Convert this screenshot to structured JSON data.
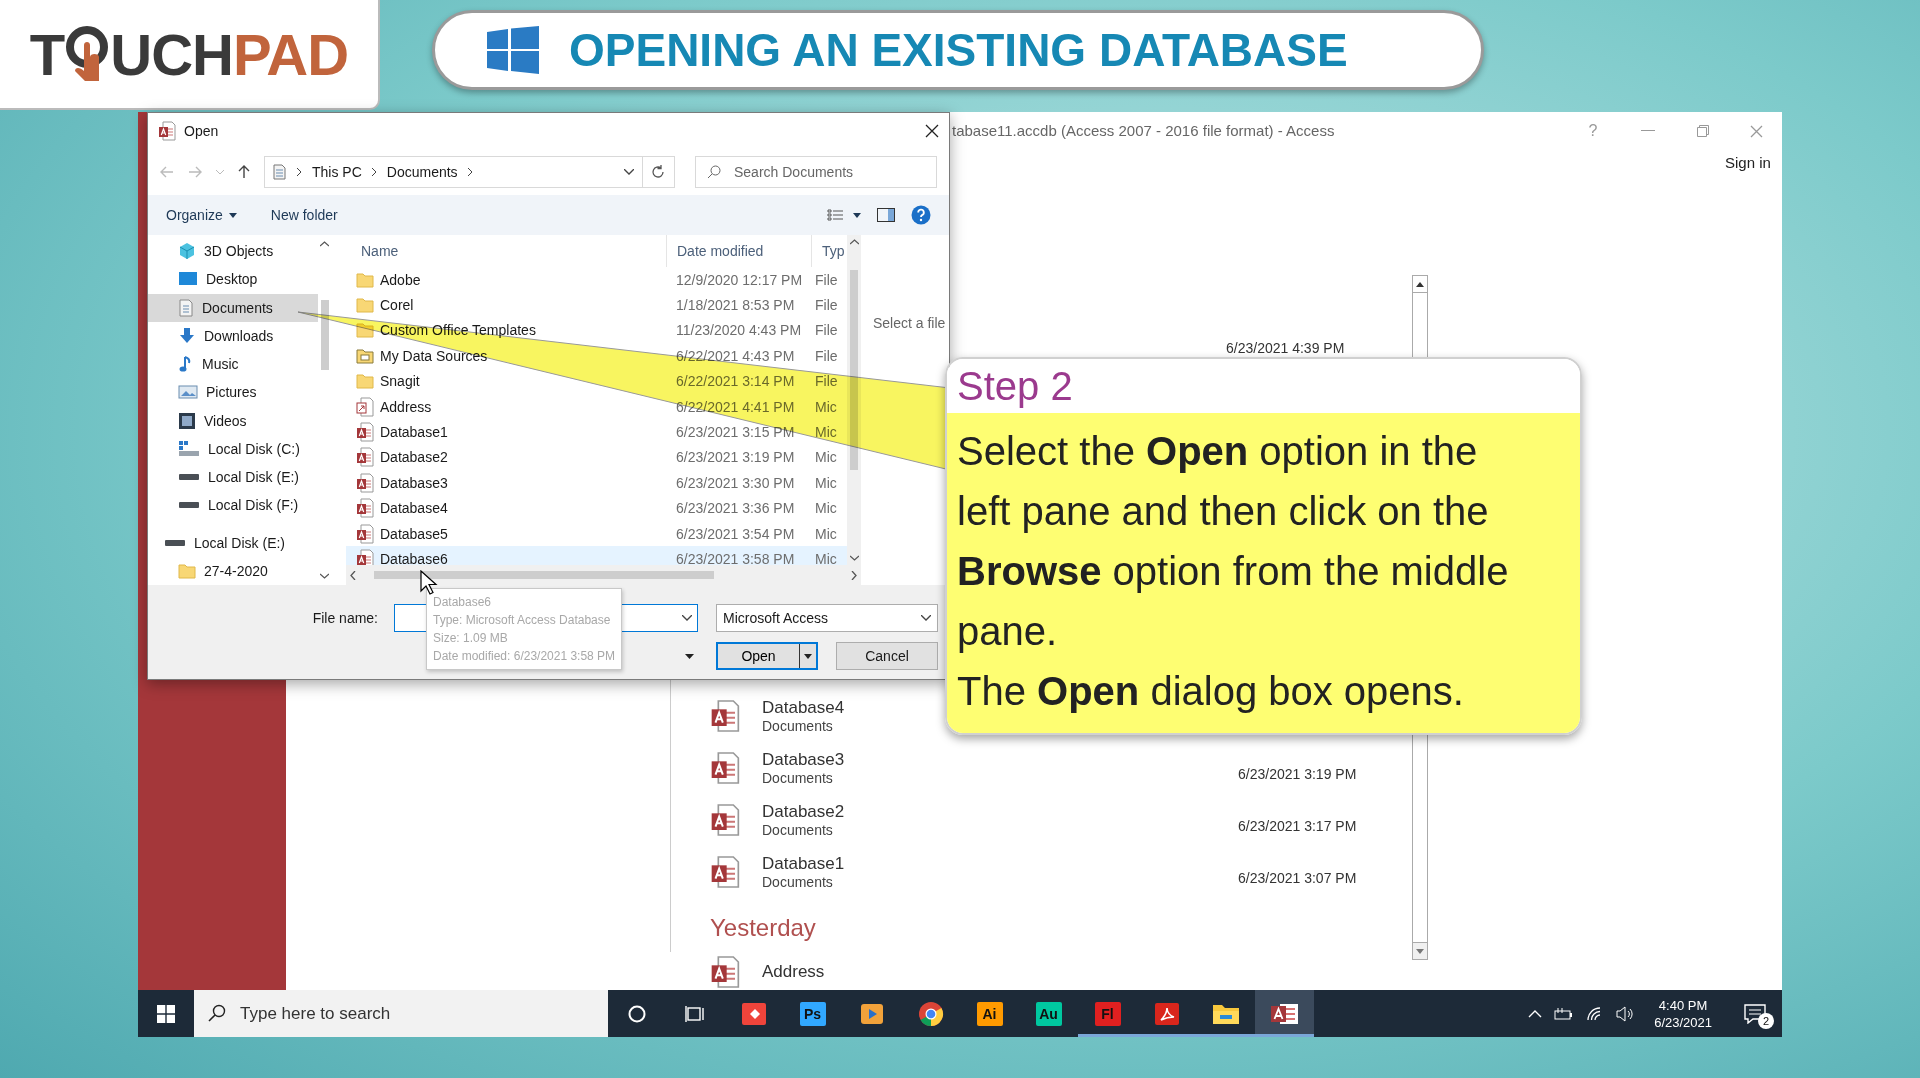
{
  "header": {
    "logo": {
      "start": "T",
      "middle": "UCH",
      "accent": "PAD"
    },
    "title": "OPENING AN EXISTING DATABASE"
  },
  "access_window": {
    "title": "tabase11.accdb (Access 2007 - 2016 file format) - Access",
    "help": "?",
    "sign_in": "Sign in",
    "top_date": "6/23/2021 4:39 PM",
    "recent": [
      {
        "kind": "file",
        "name": "Database4",
        "location": "Documents"
      },
      {
        "kind": "file",
        "name": "Database3",
        "location": "Documents",
        "date": "6/23/2021 3:19 PM"
      },
      {
        "kind": "file",
        "name": "Database2",
        "location": "Documents",
        "date": "6/23/2021 3:17 PM"
      },
      {
        "kind": "file",
        "name": "Database1",
        "location": "Documents",
        "date": "6/23/2021 3:07 PM"
      },
      {
        "kind": "group",
        "label": "Yesterday"
      },
      {
        "kind": "file",
        "name": "Address"
      }
    ]
  },
  "dialog": {
    "title": "Open",
    "path": [
      "This PC",
      "Documents"
    ],
    "search": {
      "placeholder": "Search Documents"
    },
    "toolbar": {
      "organize": "Organize",
      "new_folder": "New folder"
    },
    "nav": [
      {
        "kind": "objects",
        "label": "3D Objects",
        "selected": false
      },
      {
        "kind": "desktop",
        "label": "Desktop",
        "selected": false
      },
      {
        "kind": "documents",
        "label": "Documents",
        "selected": true
      },
      {
        "kind": "downloads",
        "label": "Downloads",
        "selected": false
      },
      {
        "kind": "music",
        "label": "Music",
        "selected": false
      },
      {
        "kind": "pictures",
        "label": "Pictures",
        "selected": false
      },
      {
        "kind": "videos",
        "label": "Videos",
        "selected": false
      },
      {
        "kind": "system-drive",
        "label": "Local Disk (C:)",
        "selected": false
      },
      {
        "kind": "drive",
        "label": "Local Disk (E:)",
        "selected": false
      },
      {
        "kind": "drive",
        "label": "Local Disk (F:)",
        "selected": false
      },
      {
        "kind": "drive",
        "label": "Local Disk (E:)",
        "selected": false,
        "children": [
          {
            "kind": "folder",
            "label": "27-4-2020",
            "selected": false
          }
        ]
      }
    ],
    "columns": [
      "Name",
      "Date modified",
      "Typ"
    ],
    "files": [
      {
        "kind": "folder",
        "name": "Adobe",
        "date": "12/9/2020 12:17 PM",
        "type": "File",
        "selected": false
      },
      {
        "kind": "folder",
        "name": "Corel",
        "date": "1/18/2021 8:53 PM",
        "type": "File",
        "selected": false
      },
      {
        "kind": "folder",
        "name": "Custom Office Templates",
        "date": "11/23/2020 4:43 PM",
        "type": "File",
        "selected": false
      },
      {
        "kind": "data-folder",
        "name": "My Data Sources",
        "date": "6/22/2021 4:43 PM",
        "type": "File",
        "selected": false
      },
      {
        "kind": "folder",
        "name": "Snagit",
        "date": "6/22/2021 3:14 PM",
        "type": "File",
        "selected": false
      },
      {
        "kind": "shortcut",
        "name": "Address",
        "date": "6/22/2021 4:41 PM",
        "type": "Mic",
        "selected": false
      },
      {
        "kind": "access",
        "name": "Database1",
        "date": "6/23/2021 3:15 PM",
        "type": "Mic",
        "selected": false
      },
      {
        "kind": "access",
        "name": "Database2",
        "date": "6/23/2021 3:19 PM",
        "type": "Mic",
        "selected": false
      },
      {
        "kind": "access",
        "name": "Database3",
        "date": "6/23/2021 3:30 PM",
        "type": "Mic",
        "selected": false
      },
      {
        "kind": "access",
        "name": "Database4",
        "date": "6/23/2021 3:36 PM",
        "type": "Mic",
        "selected": false
      },
      {
        "kind": "access",
        "name": "Database5",
        "date": "6/23/2021 3:54 PM",
        "type": "Mic",
        "selected": false
      },
      {
        "kind": "access",
        "name": "Database6",
        "date": "6/23/2021 3:58 PM",
        "type": "Mic",
        "selected": true
      }
    ],
    "preview_hint": "Select a file",
    "file_name": {
      "label": "File name:"
    },
    "filter": "Microsoft Access",
    "buttons": {
      "open": "Open",
      "cancel": "Cancel"
    },
    "tooltip": [
      "Database6",
      "Type: Microsoft Access Database",
      "Size: 1.09 MB",
      "Date modified: 6/23/2021 3:58 PM"
    ]
  },
  "callout": {
    "title": "Step 2",
    "paragraphs": [
      "Select the **Open** option in the left pane and then click on the **Browse** option from the middle pane.",
      "The **Open** dialog box opens."
    ]
  },
  "taskbar": {
    "search": {
      "placeholder": "Type here to search"
    },
    "apps": [
      {
        "kind": "diamond",
        "selected": false,
        "running": false
      },
      {
        "kind": "badge",
        "label": "Ps",
        "color": "#31a8ff",
        "selected": false,
        "running": false
      },
      {
        "kind": "player",
        "selected": false,
        "running": false
      },
      {
        "kind": "chrome",
        "selected": false,
        "running": false
      },
      {
        "kind": "badge",
        "label": "Ai",
        "color": "#ff9a00",
        "selected": false,
        "running": false
      },
      {
        "kind": "badge",
        "label": "Au",
        "color": "#00c8a0",
        "selected": false,
        "running": false
      },
      {
        "kind": "badge",
        "label": "Fl",
        "color": "#e02020",
        "selected": false,
        "running": true
      },
      {
        "kind": "pdf",
        "selected": false,
        "running": true
      },
      {
        "kind": "explorer",
        "selected": false,
        "running": true
      },
      {
        "kind": "access",
        "selected": true,
        "running": true
      }
    ],
    "time": "4:40 PM",
    "date": "6/23/2021",
    "notifications": "2"
  }
}
